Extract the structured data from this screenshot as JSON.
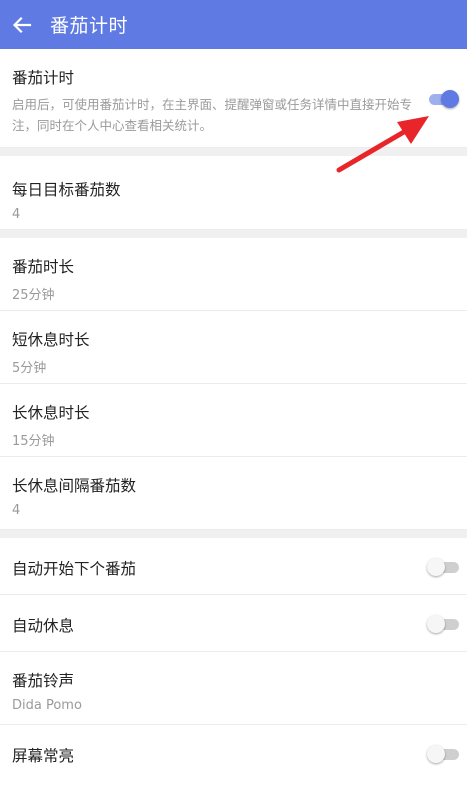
{
  "header": {
    "title": "番茄计时",
    "back_icon": "arrow-left-icon",
    "bg_color": "#5f7be3"
  },
  "pomodoro_toggle": {
    "title": "番茄计时",
    "description": "启用后，可使用番茄计时，在主界面、提醒弹窗或任务详情中直接开始专注，同时在个人中心查看相关统计。",
    "enabled": true
  },
  "daily_goal": {
    "title": "每日目标番茄数",
    "value": "4"
  },
  "durations": [
    {
      "title": "番茄时长",
      "value": "25分钟"
    },
    {
      "title": "短休息时长",
      "value": "5分钟"
    },
    {
      "title": "长休息时长",
      "value": "15分钟"
    },
    {
      "title": "长休息间隔番茄数",
      "value": "4"
    }
  ],
  "options": {
    "auto_next": {
      "title": "自动开始下个番茄",
      "enabled": false
    },
    "auto_rest": {
      "title": "自动休息",
      "enabled": false
    },
    "ringtone": {
      "title": "番茄铃声",
      "value": "Dida Pomo"
    },
    "screen_on": {
      "title": "屏幕常亮",
      "enabled": false
    }
  },
  "annotation": {
    "arrow_color": "#e8262a"
  }
}
